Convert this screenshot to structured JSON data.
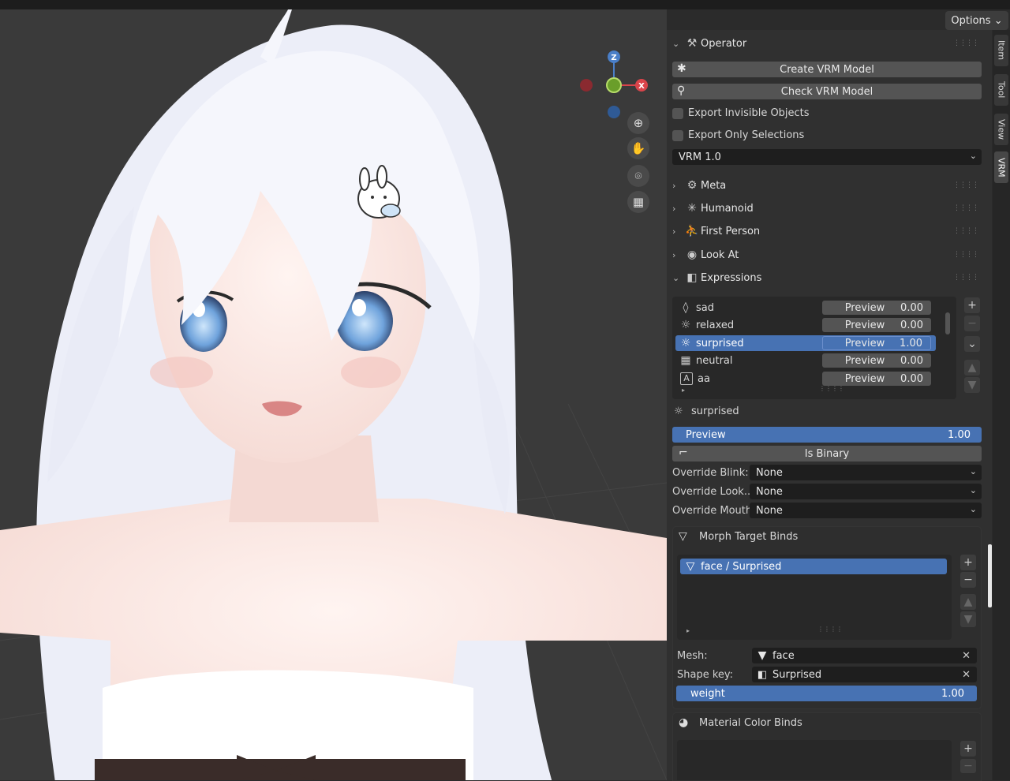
{
  "header": {
    "options_label": "Options"
  },
  "tabs": [
    "Item",
    "Tool",
    "View",
    "VRM"
  ],
  "viewport": {
    "gizmo": {
      "z": "Z",
      "x": "X"
    },
    "nav_icons": [
      "zoom-icon",
      "hand-icon",
      "camera-icon",
      "grid-icon"
    ]
  },
  "operator": {
    "title": "Operator",
    "create_label": "Create VRM Model",
    "check_label": "Check VRM Model",
    "export_invisible": "Export Invisible Objects",
    "export_selections": "Export Only Selections",
    "version": "VRM 1.0"
  },
  "sections": {
    "meta": "Meta",
    "humanoid": "Humanoid",
    "first_person": "First Person",
    "look_at": "Look At",
    "expressions": "Expressions"
  },
  "expressions": {
    "items": [
      {
        "name": "sad",
        "preview": "Preview",
        "value": "0.00",
        "icon": "drop-icon"
      },
      {
        "name": "relaxed",
        "preview": "Preview",
        "value": "0.00",
        "icon": "sun-icon"
      },
      {
        "name": "surprised",
        "preview": "Preview",
        "value": "1.00",
        "icon": "sun-icon"
      },
      {
        "name": "neutral",
        "preview": "Preview",
        "value": "0.00",
        "icon": "grid-icon"
      },
      {
        "name": "aa",
        "preview": "Preview",
        "value": "0.00",
        "icon": "letter-a-icon"
      }
    ],
    "selected_name": "surprised",
    "preview_label": "Preview",
    "preview_value": "1.00",
    "is_binary_label": "Is Binary",
    "override_blink_label": "Override Blink:",
    "override_blink_value": "None",
    "override_look_label": "Override Look...",
    "override_look_value": "None",
    "override_mouth_label": "Override Mouth:",
    "override_mouth_value": "None"
  },
  "morph_target_binds": {
    "title": "Morph Target Binds",
    "item": "face / Surprised",
    "mesh_label": "Mesh:",
    "mesh_value": "face",
    "shape_key_label": "Shape key:",
    "shape_key_value": "Surprised",
    "weight_label": "weight",
    "weight_value": "1.00"
  },
  "material_color_binds": {
    "title": "Material Color Binds"
  }
}
